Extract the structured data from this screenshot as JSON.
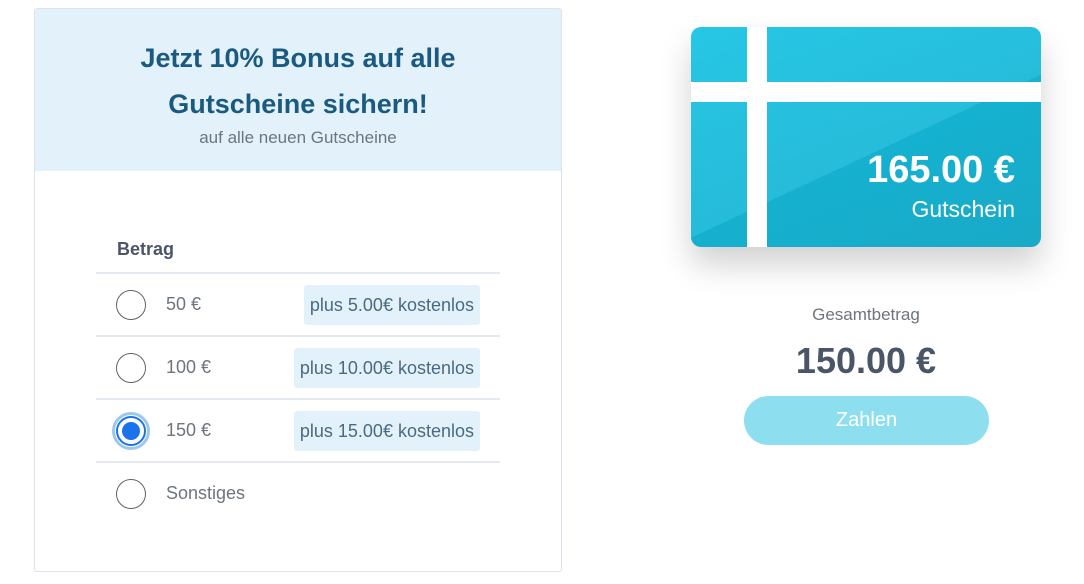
{
  "promo": {
    "title": "Jetzt 10% Bonus auf alle Gutscheine sichern!",
    "subtitle": "auf alle neuen Gutscheine"
  },
  "amount": {
    "label": "Betrag",
    "options": [
      {
        "value": "50 €",
        "bonus": "plus 5.00€ kostenlos",
        "selected": false
      },
      {
        "value": "100 €",
        "bonus": "plus 10.00€ kostenlos",
        "selected": false
      },
      {
        "value": "150 €",
        "bonus": "plus 15.00€ kostenlos",
        "selected": true
      },
      {
        "value": "Sonstiges",
        "bonus": "",
        "selected": false
      }
    ]
  },
  "card": {
    "amount": "165.00 €",
    "label": "Gutschein"
  },
  "summary": {
    "total_label": "Gesamtbetrag",
    "total_value": "150.00 €",
    "pay_label": "Zahlen"
  },
  "colors": {
    "accent": "#15b9d9",
    "title": "#1b5a80",
    "header_bg": "#e3f2fa",
    "button_bg": "#8ddff0",
    "radio_selected": "#1a73e8"
  }
}
